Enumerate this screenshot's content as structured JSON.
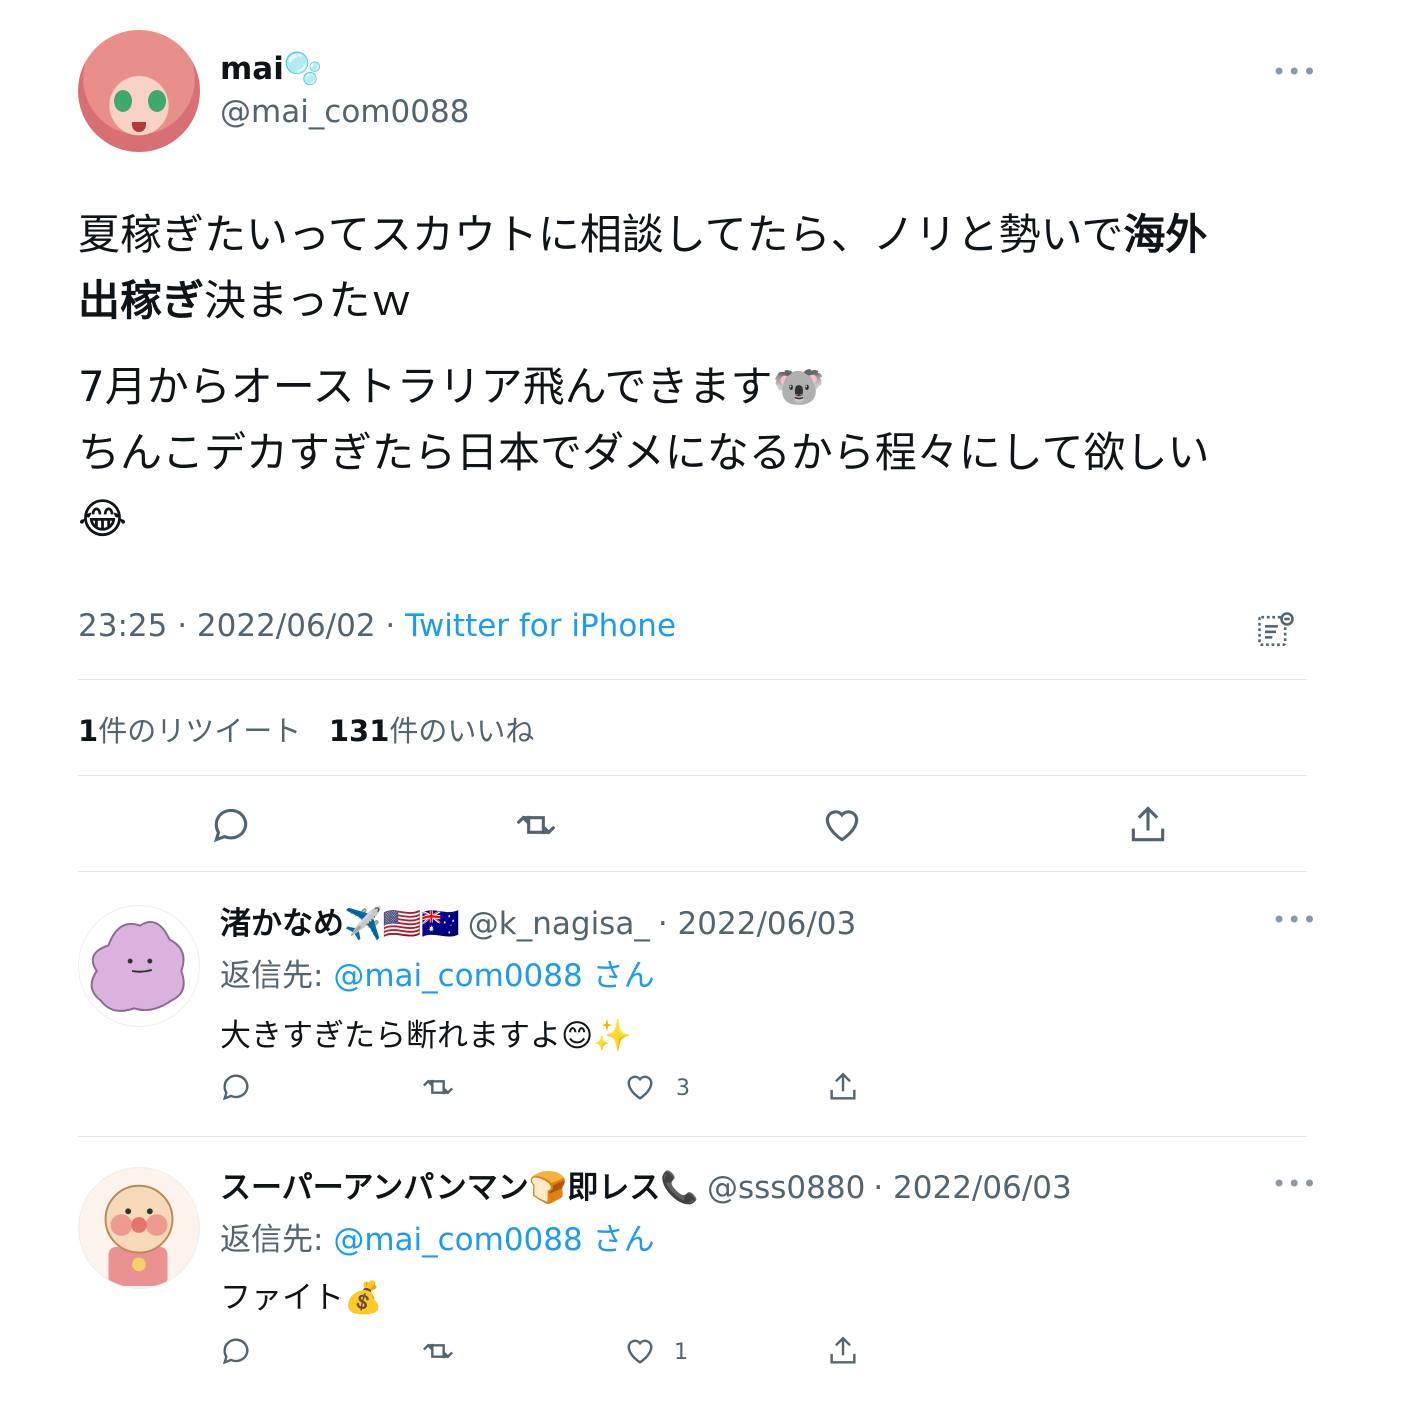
{
  "tweet": {
    "author_name": "mai🫧",
    "author_handle": "@mai_com0088",
    "text_line1_pre": "夏稼ぎたいってスカウトに相談してたら、ノリと勢いで",
    "text_line1_bold": "海外",
    "text_line2_bold": "出稼ぎ",
    "text_line2_post": "決まったｗ",
    "text_para2_line1": "7月からオーストラリア飛んできます🐨",
    "text_para2_line2": "ちんこデカすぎたら日本でダメになるから程々にして欲しい",
    "text_para2_line3": "😂",
    "time": "23:25 · 2022/06/02 · ",
    "source": "Twitter for iPhone",
    "retweet_count": "1",
    "retweet_label": "件のリツイート",
    "like_count": "131",
    "like_label": "件のいいね"
  },
  "replies": [
    {
      "name": "渚かなめ✈️🇺🇸🇦🇺",
      "handle": "@k_nagisa_",
      "date": "· 2022/06/03",
      "reply_prefix": "返信先: ",
      "reply_mention": "@mai_com0088",
      "reply_suffix": " さん",
      "text": "大きすぎたら断れますよ😊✨",
      "like_count": "3"
    },
    {
      "name": "スーパーアンパンマン🍞即レス📞",
      "handle": "@sss0880",
      "date": "· 2022/06/03",
      "reply_prefix": "返信先: ",
      "reply_mention": "@mai_com0088",
      "reply_suffix": " さん",
      "text": "ファイト💰",
      "like_count": "1"
    }
  ],
  "more_glyph": "•••",
  "icons": [
    "reply-icon",
    "retweet-icon",
    "like-icon",
    "share-icon",
    "analytics-icon",
    "more-icon"
  ],
  "colors": {
    "link": "#1d9bf0",
    "secondary": "#536471",
    "text": "#0f1419",
    "divider": "#e1e6ea"
  }
}
